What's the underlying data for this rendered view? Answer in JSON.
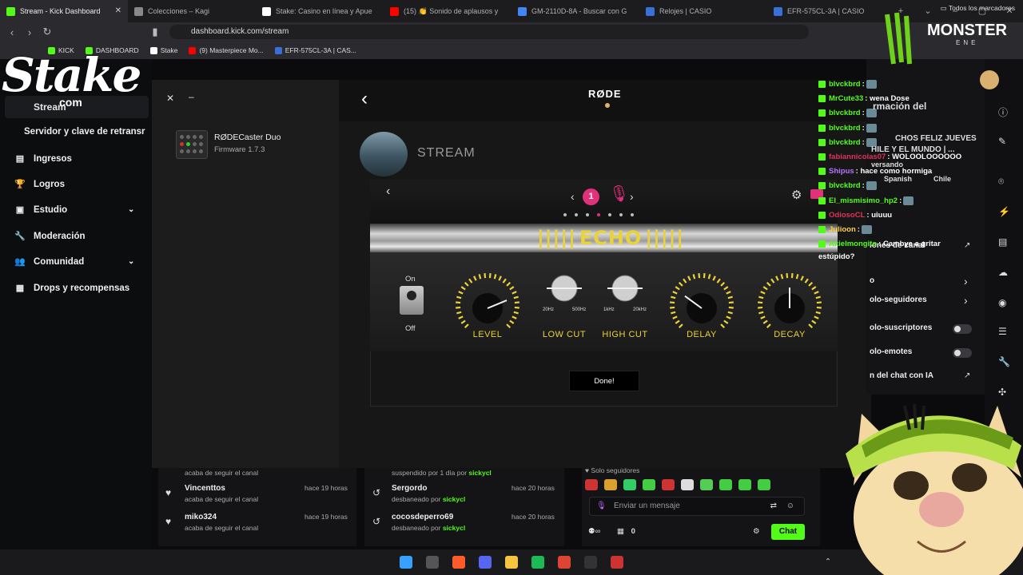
{
  "browser": {
    "tabs": [
      {
        "title": "Stream - Kick Dashboard",
        "active": true,
        "color": "#53fc18"
      },
      {
        "title": "Colecciones – Kagi",
        "active": false,
        "color": "#888888"
      },
      {
        "title": "Stake: Casino en línea y Apue",
        "active": false,
        "color": "#ffffff"
      },
      {
        "title": "(15) 👏 Sonido de aplausos y",
        "active": false,
        "color": "#ff0000"
      },
      {
        "title": "GM-2110D-8A - Buscar con G",
        "active": false,
        "color": "#4285f4"
      },
      {
        "title": "Relojes | CASIO",
        "active": false,
        "color": "#3a6fd8"
      },
      {
        "title": "EFR-575CL-3A | CASIO",
        "active": false,
        "color": "#3a6fd8"
      }
    ],
    "url": "dashboard.kick.com/stream",
    "bookmarks": [
      "KICK",
      "DASHBOARD",
      "Stake",
      "(9) Masterpiece Mo...",
      "EFR-575CL-3A | CAS..."
    ],
    "all_bookmarks": "Todos los marcadores"
  },
  "sidebar": {
    "stream": "Stream",
    "sub_item": "Servidor y clave de retransr",
    "items": [
      {
        "label": "Ingresos",
        "icon": "bars-icon",
        "glyph": "▤"
      },
      {
        "label": "Logros",
        "icon": "trophy-icon",
        "glyph": "🏆"
      },
      {
        "label": "Estudio",
        "icon": "studio-icon",
        "glyph": "▣",
        "chevron": true
      },
      {
        "label": "Moderación",
        "icon": "wrench-icon",
        "glyph": "🔧"
      },
      {
        "label": "Comunidad",
        "icon": "users-icon",
        "glyph": "👥",
        "chevron": true
      },
      {
        "label": "Drops y recompensas",
        "icon": "drops-icon",
        "glyph": "▦"
      }
    ]
  },
  "rode": {
    "logo": "RØDE",
    "device_name": "RØDECaster Duo",
    "firmware": "Firmware 1.7.3",
    "stream_label": "STREAM",
    "channel": "1",
    "effect": "ECHO",
    "toggle_on": "On",
    "toggle_off": "Off",
    "knobs": [
      {
        "label": "LEVEL",
        "value": 0.75
      },
      {
        "label": "LOW CUT",
        "min": "20Hz",
        "max": "500Hz",
        "value": 0.5
      },
      {
        "label": "HIGH CUT",
        "min": "1kHz",
        "max": "20kHz",
        "value": 0.5
      },
      {
        "label": "DELAY",
        "value": 0.3
      },
      {
        "label": "DECAY",
        "value": 0.5
      }
    ],
    "done": "Done!"
  },
  "activity": {
    "follows": [
      {
        "name": "",
        "sub": "acaba de seguir el canal",
        "time": ""
      },
      {
        "name": "Vincenttos",
        "sub": "acaba de seguir el canal",
        "time": "hace 19 horas"
      },
      {
        "name": "miko324",
        "sub": "acaba de seguir el canal",
        "time": "hace 19 horas"
      }
    ],
    "mod": [
      {
        "name": "",
        "sub": "suspendido por 1 día por",
        "by": "sickycl",
        "time": ""
      },
      {
        "name": "Sergordo",
        "sub": "desbaneado por",
        "by": "sickycl",
        "time": "hace 20 horas"
      },
      {
        "name": "cocosdeperro69",
        "sub": "desbaneado por",
        "by": "sickycl",
        "time": "hace 20 horas"
      }
    ]
  },
  "chat": {
    "mode": "Solo seguidores",
    "placeholder": "Enviar un mensaje",
    "send": "Chat",
    "count": "0",
    "messages": [
      {
        "user": "blvckbrd",
        "color": "#53fc18",
        "text": ":"
      },
      {
        "user": "MrCute33",
        "color": "#53fc18",
        "text": ": wena Dose"
      },
      {
        "user": "blvckbrd",
        "color": "#53fc18",
        "text": ":"
      },
      {
        "user": "blvckbrd",
        "color": "#53fc18",
        "text": ":"
      },
      {
        "user": "blvckbrd",
        "color": "#53fc18",
        "text": ":"
      },
      {
        "user": "fabiannicolas07",
        "color": "#e0315a",
        "text": ": WOLOOLOOOOOO"
      },
      {
        "user": "Shipus",
        "color": "#b276ff",
        "text": ": hace como hormiga"
      },
      {
        "user": "blvckbrd",
        "color": "#53fc18",
        "text": ":"
      },
      {
        "user": "El_mismisimo_hp2",
        "color": "#53fc18",
        "text": ":"
      },
      {
        "user": "OdiosoCL",
        "color": "#e0315a",
        "text": ": uiuuu"
      },
      {
        "user": "Julioon",
        "color": "#ffd23a",
        "text": ":"
      },
      {
        "user": "Akielmongito",
        "color": "#53fc18",
        "text": ": Cambye a gritar"
      }
    ],
    "overflow_text": "estúpido?",
    "bg_fragments": [
      "rmación del",
      "CHOS FELIZ JUEVES",
      "HILE Y EL MUNDO | ...",
      "versando",
      "Spanish",
      "Chile"
    ]
  },
  "settings": {
    "rows": [
      {
        "label": "lones de canal",
        "kind": "link"
      },
      {
        "label": "o",
        "kind": "chevron"
      },
      {
        "label": "olo-seguidores",
        "kind": "chevron"
      },
      {
        "label": "olo-suscriptores",
        "kind": "switch"
      },
      {
        "label": "olo-emotes",
        "kind": "switch"
      },
      {
        "label": "n del chat con IA",
        "kind": "link"
      }
    ]
  },
  "overlays": {
    "stake": "Stake",
    "stake_com": "com",
    "monster": "MONSTER",
    "monster_sub": "ENE"
  }
}
